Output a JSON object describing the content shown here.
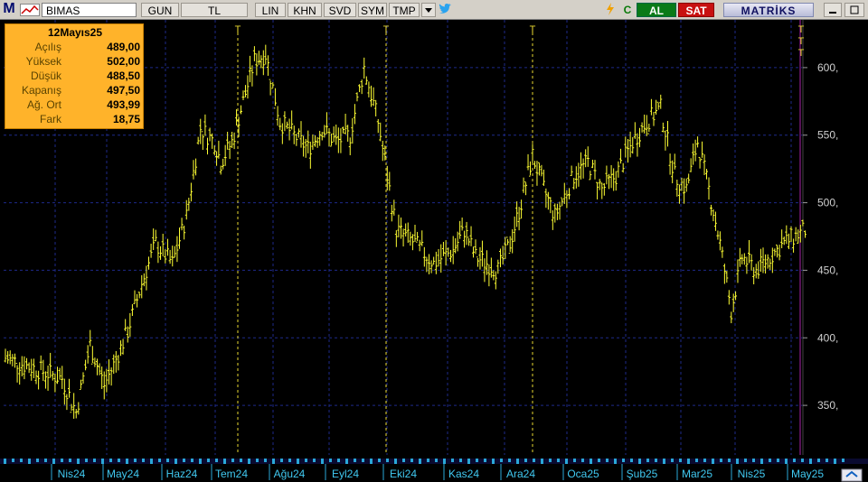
{
  "toolbar": {
    "app_glyph": "M",
    "symbol": "BIMAS",
    "period": "GUN",
    "currency": "TL",
    "lin": "LIN",
    "khn": "KHN",
    "svd": "SVD",
    "sym": "SYM",
    "tmp": "TMP",
    "dropdown_icon": "dropdown-icon",
    "twitter_icon": "twitter-icon",
    "bolt_icon": "lightning-icon",
    "c_label": "C",
    "buy_label": "AL",
    "sell_label": "SAT",
    "brand": "MATRİKS",
    "buy_color": "#0a7a18",
    "sell_color": "#c81010"
  },
  "info_box": {
    "date": "12Mayıs25",
    "rows": [
      {
        "label": "Açılış",
        "value": "489,00"
      },
      {
        "label": "Yüksek",
        "value": "502,00"
      },
      {
        "label": "Düşük",
        "value": "488,50"
      },
      {
        "label": "Kapanış",
        "value": "497,50"
      },
      {
        "label": "Ağ. Ort",
        "value": "493,99"
      },
      {
        "label": "Fark",
        "value": "18,75"
      }
    ]
  },
  "chart_data": {
    "type": "ohlc",
    "symbol": "BIMAS",
    "price_color": "#ffff33",
    "background": "#000000",
    "grid": true,
    "ylim": [
      320,
      630
    ],
    "y_ticks": [
      "600,",
      "550,",
      "500,",
      "450,",
      "400,",
      "350,"
    ],
    "y_tick_values": [
      600,
      550,
      500,
      450,
      400,
      350
    ],
    "x_ticks": [
      "Nis24",
      "May24",
      "Haz24",
      "Tem24",
      "Ağu24",
      "Eyl24",
      "Eki24",
      "Kas24",
      "Ara24",
      "Oca25",
      "Şub25",
      "Mar25",
      "Nis25",
      "May25"
    ],
    "markers": [
      {
        "label": "T",
        "date": "Tem24"
      },
      {
        "label": "T",
        "date": "Eki24"
      },
      {
        "label": "T",
        "date": "Ara24"
      }
    ],
    "marker_stack_labels": [
      "T",
      "T",
      "T"
    ],
    "anchor_points": [
      [
        "Mar24",
        385
      ],
      [
        "Nis24",
        370
      ],
      [
        "Nis24",
        345
      ],
      [
        "Nis24",
        395
      ],
      [
        "Nis24",
        365
      ],
      [
        "May24",
        380
      ],
      [
        "May24",
        405
      ],
      [
        "May24",
        440
      ],
      [
        "May24",
        470
      ],
      [
        "Haz24",
        455
      ],
      [
        "Haz24",
        490
      ],
      [
        "Haz24",
        555
      ],
      [
        "Haz24",
        545
      ],
      [
        "Tem24",
        530
      ],
      [
        "Tem24",
        545
      ],
      [
        "Tem24",
        575
      ],
      [
        "Tem24",
        605
      ],
      [
        "Tem24",
        610
      ],
      [
        "Ağu24",
        560
      ],
      [
        "Ağu24",
        550
      ],
      [
        "Ağu24",
        540
      ],
      [
        "Ağu24",
        555
      ],
      [
        "Eyl24",
        545
      ],
      [
        "Eyl24",
        550
      ],
      [
        "Eyl24",
        600
      ],
      [
        "Eyl24",
        560
      ],
      [
        "Eki24",
        480
      ],
      [
        "Eki24",
        470
      ],
      [
        "Eki24",
        455
      ],
      [
        "Kas24",
        465
      ],
      [
        "Kas24",
        480
      ],
      [
        "Kas24",
        460
      ],
      [
        "Kas24",
        455
      ],
      [
        "Kas24",
        450
      ],
      [
        "Ara24",
        470
      ],
      [
        "Ara24",
        500
      ],
      [
        "Ara24",
        535
      ],
      [
        "Ara24",
        510
      ],
      [
        "Ara24",
        490
      ],
      [
        "Oca25",
        520
      ],
      [
        "Oca25",
        530
      ],
      [
        "Oca25",
        510
      ],
      [
        "Oca25",
        520
      ],
      [
        "Şub25",
        545
      ],
      [
        "Şub25",
        560
      ],
      [
        "Şub25",
        570
      ],
      [
        "Şub25",
        520
      ],
      [
        "Mar25",
        510
      ],
      [
        "Mar25",
        545
      ],
      [
        "Mar25",
        510
      ],
      [
        "Mar25",
        470
      ],
      [
        "Mar25",
        420
      ],
      [
        "Nis25",
        460
      ],
      [
        "Nis25",
        450
      ],
      [
        "Nis25",
        460
      ],
      [
        "Nis25",
        470
      ],
      [
        "May25",
        480
      ],
      [
        "May25",
        497.5
      ]
    ]
  }
}
